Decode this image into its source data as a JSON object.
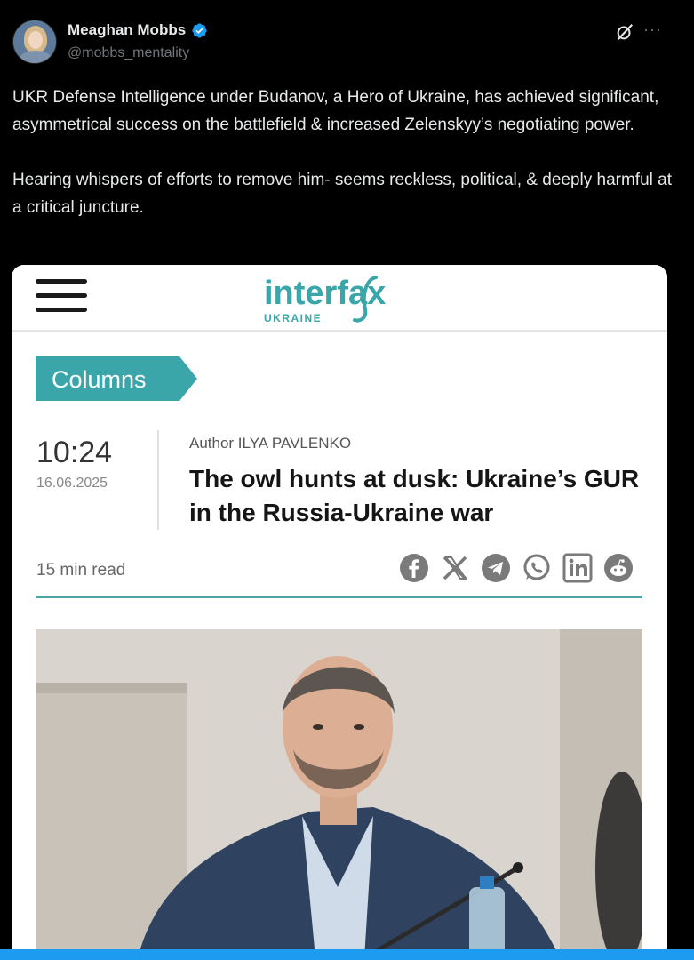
{
  "tweet": {
    "author": {
      "display_name": "Meaghan Mobbs",
      "handle": "@mobbs_mentality",
      "verified": true
    },
    "paragraphs": [
      "UKR Defense Intelligence under Budanov, a Hero of Ukraine, has achieved significant, asymmetrical success on the battlefield & increased Zelenskyy’s negotiating power.",
      "Hearing whispers of efforts to remove him- seems reckless, political, & deeply harmful at a critical juncture."
    ],
    "actions": {
      "more_label": "···"
    }
  },
  "card": {
    "site": {
      "logo_main": "interfax",
      "logo_sub": "UKRAINE",
      "brand_color": "#3aa6a9"
    },
    "section_tag": "Columns",
    "time": "10:24",
    "date": "16.06.2025",
    "author_line": "Author ILYA PAVLENKO",
    "headline": "The owl hunts at dusk: Ukraine’s GUR in the Russia-Ukraine war",
    "read_time": "15 min read",
    "share_icons": [
      "facebook-icon",
      "x-icon",
      "telegram-icon",
      "whatsapp-icon",
      "linkedin-icon",
      "reddit-icon"
    ]
  },
  "colors": {
    "background": "#000000",
    "text": "#e7e9ea",
    "muted": "#71767b",
    "verified_blue": "#1d9bf0",
    "accent_teal": "#4da4a5"
  }
}
